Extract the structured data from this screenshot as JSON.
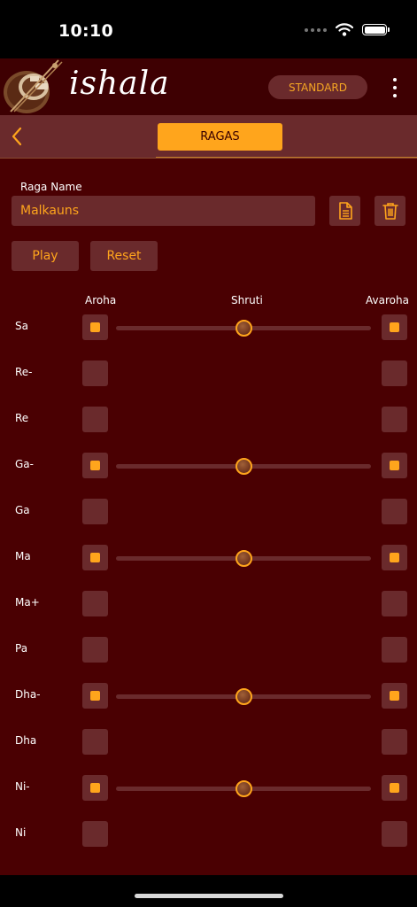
{
  "status_bar": {
    "time": "10:10"
  },
  "header": {
    "logo_text": "ishala",
    "standard_label": "STANDARD"
  },
  "nav": {
    "tab_label": "RAGAS"
  },
  "form": {
    "raga_name_label": "Raga Name",
    "raga_name_value": "Malkauns",
    "play_label": "Play",
    "reset_label": "Reset"
  },
  "columns": {
    "aroha": "Aroha",
    "shruti": "Shruti",
    "avaroha": "Avaroha"
  },
  "notes": [
    {
      "label": "Sa",
      "aroha": true,
      "avaroha": true,
      "shruti": 0.5
    },
    {
      "label": "Re-",
      "aroha": false,
      "avaroha": false,
      "shruti": null
    },
    {
      "label": "Re",
      "aroha": false,
      "avaroha": false,
      "shruti": null
    },
    {
      "label": "Ga-",
      "aroha": true,
      "avaroha": true,
      "shruti": 0.5
    },
    {
      "label": "Ga",
      "aroha": false,
      "avaroha": false,
      "shruti": null
    },
    {
      "label": "Ma",
      "aroha": true,
      "avaroha": true,
      "shruti": 0.5
    },
    {
      "label": "Ma+",
      "aroha": false,
      "avaroha": false,
      "shruti": null
    },
    {
      "label": "Pa",
      "aroha": false,
      "avaroha": false,
      "shruti": null
    },
    {
      "label": "Dha-",
      "aroha": true,
      "avaroha": true,
      "shruti": 0.5
    },
    {
      "label": "Dha",
      "aroha": false,
      "avaroha": false,
      "shruti": null
    },
    {
      "label": "Ni-",
      "aroha": true,
      "avaroha": true,
      "shruti": 0.5
    },
    {
      "label": "Ni",
      "aroha": false,
      "avaroha": false,
      "shruti": null
    }
  ],
  "colors": {
    "accent": "#ffa51c",
    "background": "#4a0002",
    "surface": "#6a2a2c",
    "header": "#3e0002"
  },
  "icons": {
    "back": "chevron-left-icon",
    "document": "document-icon",
    "delete": "trash-icon",
    "menu": "more-vertical-icon",
    "wifi": "wifi-icon",
    "battery": "battery-icon"
  }
}
